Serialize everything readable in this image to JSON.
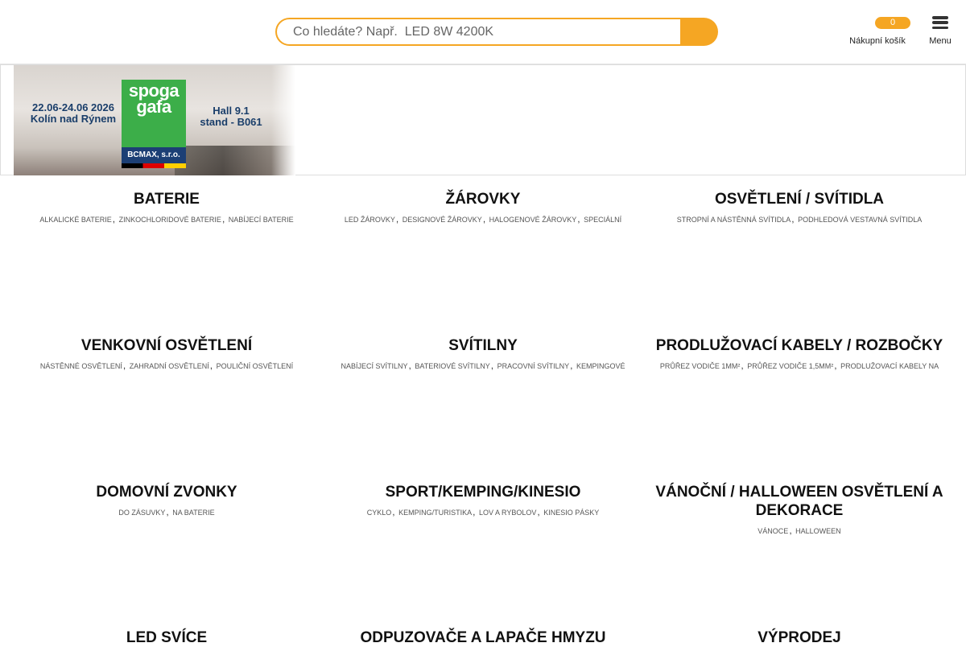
{
  "header": {
    "search": {
      "placeholder": "Co hledáte? Např.  LED 8W 4200K",
      "button_icon": "search-icon"
    },
    "cart": {
      "count": "0",
      "label": "Nákupní košík"
    },
    "menu": {
      "label": "Menu",
      "icon": "hamburger-icon"
    }
  },
  "banner": {
    "dates_line1": "22.06-24.06 2026",
    "dates_line2": "Kolín nad Rýnem",
    "logo_text_line1": "spoga",
    "logo_text_line2": "gafa",
    "company": "BCMAX, s.r.o.",
    "hall_line1": "Hall 9.1",
    "hall_line2": "stand - B061"
  },
  "categories": [
    {
      "title": "BATERIE",
      "subs": [
        "ALKALICKÉ BATERIE",
        "ZINKOCHLORIDOVÉ BATERIE",
        "NABÍJECÍ BATERIE"
      ]
    },
    {
      "title": "ŽÁROVKY",
      "subs": [
        "LED ŽÁROVKY",
        "DESIGNOVÉ ŽÁROVKY",
        "HALOGENOVÉ ŽÁROVKY",
        "SPECIÁLNÍ"
      ]
    },
    {
      "title": "OSVĚTLENÍ / SVÍTIDLA",
      "subs": [
        "STROPNÍ A NÁSTĚNNÁ SVÍTIDLA",
        "PODHLEDOVÁ VESTAVNÁ SVÍTIDLA"
      ]
    },
    {
      "title": "VENKOVNÍ OSVĚTLENÍ",
      "subs": [
        "NÁSTĚNNÉ OSVĚTLENÍ",
        "ZAHRADNÍ OSVĚTLENÍ",
        "POULIČNÍ OSVĚTLENÍ"
      ]
    },
    {
      "title": "SVÍTILNY",
      "subs": [
        "NABÍJECÍ SVÍTILNY",
        "BATERIOVÉ SVÍTILNY",
        "PRACOVNÍ SVÍTILNY",
        "KEMPINGOVÉ"
      ]
    },
    {
      "title": "PRODLUŽOVACÍ KABELY / ROZBOČKY",
      "subs": [
        "PRŮŘEZ VODIČE 1MM²",
        "PRŮŘEZ VODIČE 1,5MM²",
        "PRODLUŽOVACÍ KABELY NA"
      ]
    },
    {
      "title": "DOMOVNÍ ZVONKY",
      "subs": [
        "DO ZÁSUVKY",
        "NA BATERIE"
      ]
    },
    {
      "title": "SPORT/KEMPING/KINESIO",
      "subs": [
        "CYKLO",
        "KEMPING/TURISTIKA",
        "LOV A RYBOLOV",
        "KINESIO PÁSKY"
      ]
    },
    {
      "title": "VÁNOČNÍ / HALLOWEEN OSVĚTLENÍ A DEKORACE",
      "subs": [
        "VÁNOCE",
        "HALLOWEEN"
      ]
    },
    {
      "title": "LED SVÍCE",
      "subs": []
    },
    {
      "title": "ODPUZOVAČE A LAPAČE HMYZU",
      "subs": []
    },
    {
      "title": "VÝPRODEJ",
      "subs": []
    }
  ],
  "colors": {
    "accent": "#f5a623",
    "logo_green": "#3cae49",
    "logo_blue": "#1c3f75"
  }
}
